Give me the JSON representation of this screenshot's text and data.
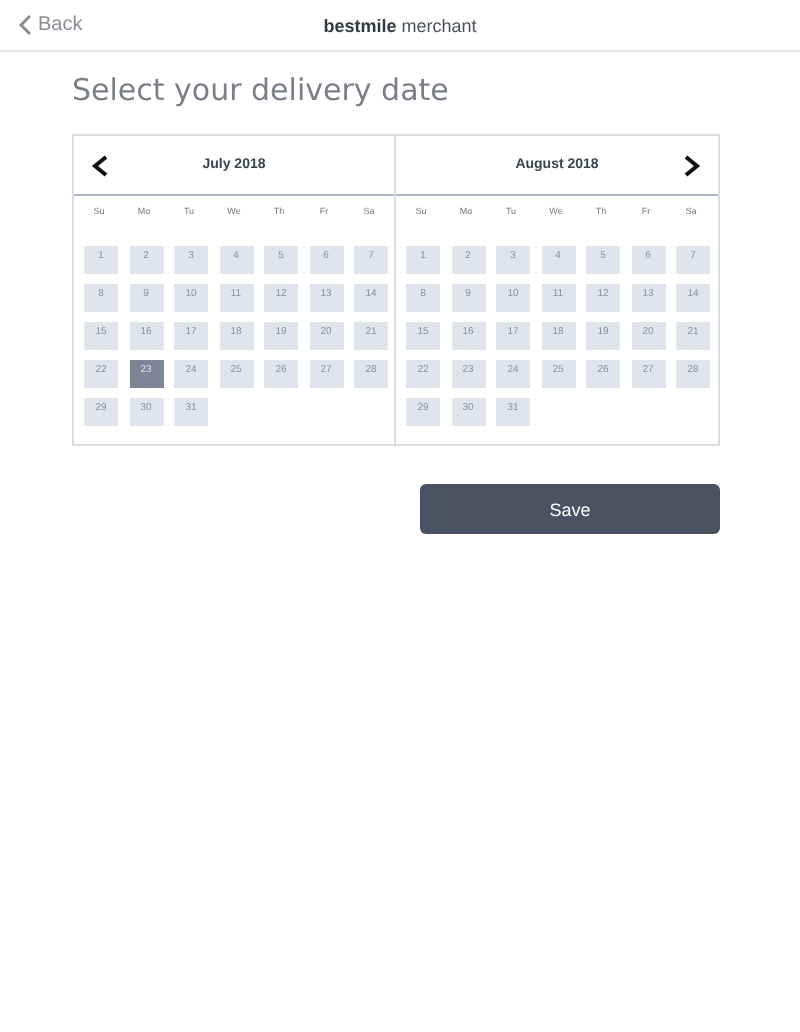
{
  "nav": {
    "back": "Back",
    "brand_bold": "bestmile",
    "brand_rest": "merchant"
  },
  "title": "Select your delivery date",
  "calendars": [
    {
      "month": "July 2018",
      "prev_button": true,
      "next_button": false,
      "weekdays": [
        "Su",
        "Mo",
        "Tu",
        "We",
        "Th",
        "Fr",
        "Sa"
      ],
      "days": [
        {
          "label": "1",
          "selected": false
        },
        {
          "label": "2",
          "selected": false
        },
        {
          "label": "3",
          "selected": false
        },
        {
          "label": "4",
          "selected": false
        },
        {
          "label": "5",
          "selected": false
        },
        {
          "label": "6",
          "selected": false
        },
        {
          "label": "7",
          "selected": false
        },
        {
          "label": "8",
          "selected": false
        },
        {
          "label": "9",
          "selected": false
        },
        {
          "label": "10",
          "selected": false
        },
        {
          "label": "11",
          "selected": false
        },
        {
          "label": "12",
          "selected": false
        },
        {
          "label": "13",
          "selected": false
        },
        {
          "label": "14",
          "selected": false
        },
        {
          "label": "15",
          "selected": false
        },
        {
          "label": "16",
          "selected": false
        },
        {
          "label": "17",
          "selected": false
        },
        {
          "label": "18",
          "selected": false
        },
        {
          "label": "19",
          "selected": false
        },
        {
          "label": "20",
          "selected": false
        },
        {
          "label": "21",
          "selected": false
        },
        {
          "label": "22",
          "selected": false
        },
        {
          "label": "23",
          "selected": true
        },
        {
          "label": "24",
          "selected": false
        },
        {
          "label": "25",
          "selected": false
        },
        {
          "label": "26",
          "selected": false
        },
        {
          "label": "27",
          "selected": false
        },
        {
          "label": "28",
          "selected": false
        },
        {
          "label": "29",
          "selected": false
        },
        {
          "label": "30",
          "selected": false
        },
        {
          "label": "31",
          "selected": false
        }
      ]
    },
    {
      "month": "August 2018",
      "prev_button": false,
      "next_button": true,
      "weekdays": [
        "Su",
        "Mo",
        "Tu",
        "We",
        "Th",
        "Fr",
        "Sa"
      ],
      "days": [
        {
          "label": "1",
          "selected": false
        },
        {
          "label": "2",
          "selected": false
        },
        {
          "label": "3",
          "selected": false
        },
        {
          "label": "4",
          "selected": false
        },
        {
          "label": "5",
          "selected": false
        },
        {
          "label": "6",
          "selected": false
        },
        {
          "label": "7",
          "selected": false
        },
        {
          "label": "8",
          "selected": false
        },
        {
          "label": "9",
          "selected": false
        },
        {
          "label": "10",
          "selected": false
        },
        {
          "label": "11",
          "selected": false
        },
        {
          "label": "12",
          "selected": false
        },
        {
          "label": "13",
          "selected": false
        },
        {
          "label": "14",
          "selected": false
        },
        {
          "label": "15",
          "selected": false
        },
        {
          "label": "16",
          "selected": false
        },
        {
          "label": "17",
          "selected": false
        },
        {
          "label": "18",
          "selected": false
        },
        {
          "label": "19",
          "selected": false
        },
        {
          "label": "20",
          "selected": false
        },
        {
          "label": "21",
          "selected": false
        },
        {
          "label": "22",
          "selected": false
        },
        {
          "label": "23",
          "selected": false
        },
        {
          "label": "24",
          "selected": false
        },
        {
          "label": "25",
          "selected": false
        },
        {
          "label": "26",
          "selected": false
        },
        {
          "label": "27",
          "selected": false
        },
        {
          "label": "28",
          "selected": false
        },
        {
          "label": "29",
          "selected": false
        },
        {
          "label": "30",
          "selected": false
        },
        {
          "label": "31",
          "selected": false
        }
      ]
    }
  ],
  "save": "Save"
}
